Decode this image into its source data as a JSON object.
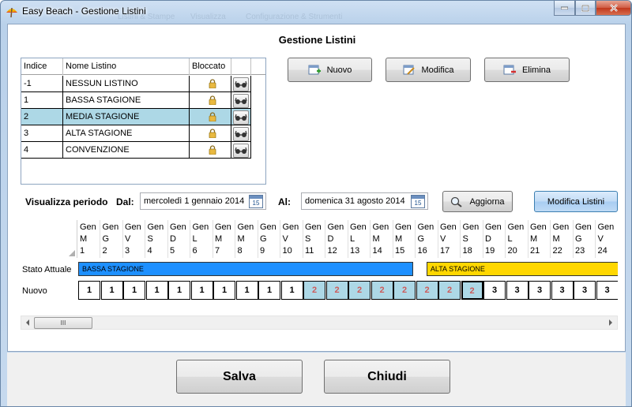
{
  "window": {
    "title": "Easy Beach - Gestione Listini",
    "ghost_tabs": [
      "Listini & Stampe",
      "Visualizza",
      "Configurazione & Strumenti"
    ]
  },
  "heading": "Gestione Listini",
  "list": {
    "headers": {
      "index": "Indice",
      "name": "Nome Listino",
      "locked": "Bloccato"
    },
    "rows": [
      {
        "index": "-1",
        "name": "NESSUN LISTINO"
      },
      {
        "index": "1",
        "name": "BASSA STAGIONE"
      },
      {
        "index": "2",
        "name": "MEDIA STAGIONE"
      },
      {
        "index": "3",
        "name": "ALTA STAGIONE"
      },
      {
        "index": "4",
        "name": "CONVENZIONE"
      }
    ],
    "selected_index": 2
  },
  "actions": {
    "new": "Nuovo",
    "edit": "Modifica",
    "delete": "Elimina"
  },
  "period": {
    "label": "Visualizza periodo",
    "from_label": "Dal:",
    "from_value": "mercoledì 1 gennaio 2014",
    "to_label": "Al:",
    "to_value": "domenica 31 agosto 2014",
    "refresh": "Aggiorna",
    "edit_lists": "Modifica Listini",
    "cal_glyph": "15"
  },
  "timeline": {
    "row_labels": {
      "state": "Stato Attuale",
      "new": "Nuovo"
    },
    "days": [
      {
        "m": "Gen",
        "w": "M",
        "d": "1",
        "n": "1"
      },
      {
        "m": "Gen",
        "w": "G",
        "d": "2",
        "n": "1"
      },
      {
        "m": "Gen",
        "w": "V",
        "d": "3",
        "n": "1"
      },
      {
        "m": "Gen",
        "w": "S",
        "d": "4",
        "n": "1"
      },
      {
        "m": "Gen",
        "w": "D",
        "d": "5",
        "n": "1"
      },
      {
        "m": "Gen",
        "w": "L",
        "d": "6",
        "n": "1"
      },
      {
        "m": "Gen",
        "w": "M",
        "d": "7",
        "n": "1"
      },
      {
        "m": "Gen",
        "w": "M",
        "d": "8",
        "n": "1"
      },
      {
        "m": "Gen",
        "w": "G",
        "d": "9",
        "n": "1"
      },
      {
        "m": "Gen",
        "w": "V",
        "d": "10",
        "n": "1"
      },
      {
        "m": "Gen",
        "w": "S",
        "d": "11",
        "n": "2"
      },
      {
        "m": "Gen",
        "w": "D",
        "d": "12",
        "n": "2"
      },
      {
        "m": "Gen",
        "w": "L",
        "d": "13",
        "n": "2"
      },
      {
        "m": "Gen",
        "w": "M",
        "d": "14",
        "n": "2"
      },
      {
        "m": "Gen",
        "w": "M",
        "d": "15",
        "n": "2"
      },
      {
        "m": "Gen",
        "w": "G",
        "d": "16",
        "n": "2"
      },
      {
        "m": "Gen",
        "w": "V",
        "d": "17",
        "n": "2"
      },
      {
        "m": "Gen",
        "w": "S",
        "d": "18",
        "n": "2"
      },
      {
        "m": "Gen",
        "w": "D",
        "d": "19",
        "n": "3"
      },
      {
        "m": "Gen",
        "w": "L",
        "d": "20",
        "n": "3"
      },
      {
        "m": "Gen",
        "w": "M",
        "d": "21",
        "n": "3"
      },
      {
        "m": "Gen",
        "w": "M",
        "d": "22",
        "n": "3"
      },
      {
        "m": "Gen",
        "w": "G",
        "d": "23",
        "n": "3"
      },
      {
        "m": "Gen",
        "w": "V",
        "d": "24",
        "n": "3"
      }
    ],
    "state_bars": [
      {
        "label": "BASSA STAGIONE",
        "color": "#1e90ff"
      },
      {
        "label": "ALTA STAGIONE",
        "color": "#ffd700"
      }
    ],
    "scroll_thumb": "III"
  },
  "footer": {
    "save": "Salva",
    "close": "Chiudi"
  }
}
